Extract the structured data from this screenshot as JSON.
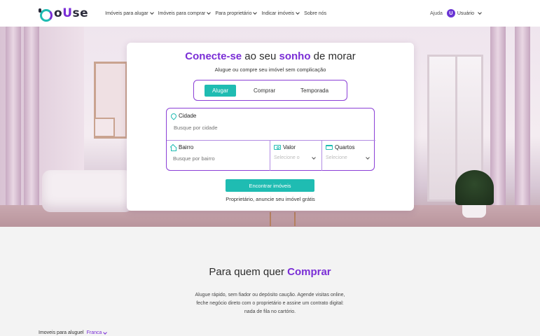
{
  "brand": {
    "logo_text_a": "o ",
    "logo_text_u": "U",
    "logo_text_b": "se"
  },
  "nav": {
    "items": [
      {
        "label": "Imóveis para alugar",
        "has_dropdown": true
      },
      {
        "label": "Imóveis para comprar",
        "has_dropdown": true
      },
      {
        "label": "Para proprietário",
        "has_dropdown": true
      },
      {
        "label": "Indicar imóveis",
        "has_dropdown": true
      },
      {
        "label": "Sobre nós",
        "has_dropdown": false
      }
    ],
    "help": "Ajuda",
    "user_initial": "U",
    "user_label": "Usuário"
  },
  "search": {
    "title_accent_1": "Conecte-se",
    "title_normal_1": " ao seu ",
    "title_accent_2": "sonho",
    "title_normal_2": " de morar",
    "subtitle": "Alugue ou compre seu imóvel sem complicação",
    "tabs": [
      {
        "label": "Alugar",
        "active": true
      },
      {
        "label": "Comprar",
        "active": false
      },
      {
        "label": "Temporada",
        "active": false
      }
    ],
    "city_label": "Cidade",
    "city_placeholder": "Busque por cidade",
    "neighborhood_label": "Bairro",
    "neighborhood_placeholder": "Busque por bairro",
    "value_label": "Valor",
    "value_placeholder": "Selecione o",
    "rooms_label": "Quartos",
    "rooms_placeholder": "Selecione",
    "submit_label": "Encontrar imóveis",
    "owner_link": "Proprietário, anuncie seu imóvel grátis"
  },
  "lower": {
    "title_normal": "Para quem quer ",
    "title_accent": "Comprar",
    "text_line_1": "Alugue rápido, sem fiador ou depósito caução. Agende visitas online,",
    "text_line_2": "feche negócio direto com o proprietário e assine um contrato digital:",
    "text_line_3": "nada de fila no cartório.",
    "strip_label": "Imoveis para aluguel",
    "strip_city": "Franca"
  },
  "colors": {
    "accent_purple": "#7a2ed6",
    "accent_teal": "#1fbcb2"
  }
}
